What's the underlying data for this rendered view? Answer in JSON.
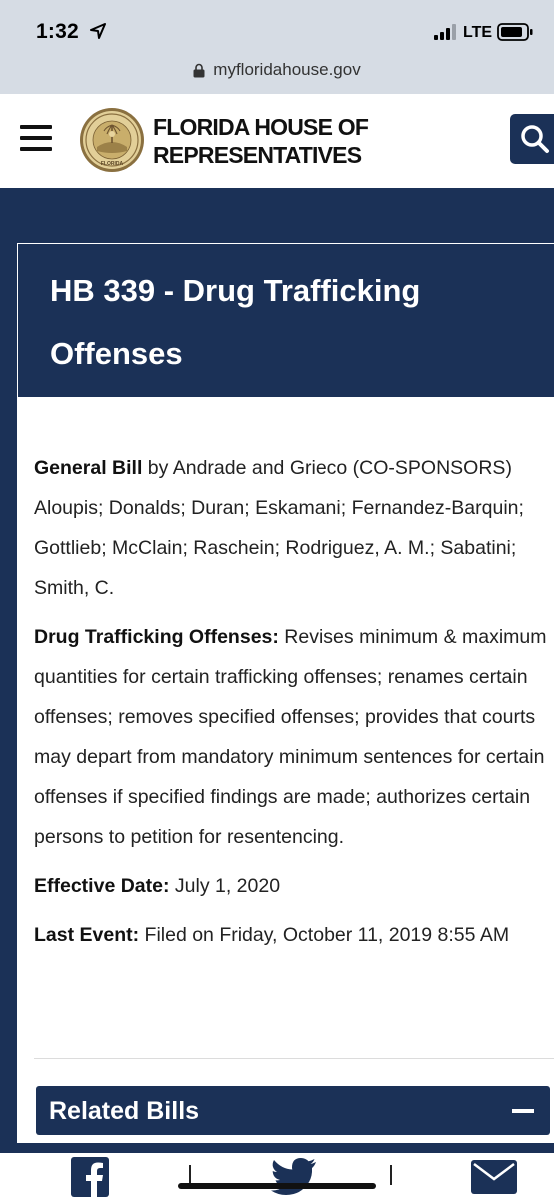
{
  "status_bar": {
    "time": "1:32",
    "network": "LTE"
  },
  "browser": {
    "url": "myfloridahouse.gov"
  },
  "header": {
    "title_line1": "FLORIDA HOUSE OF",
    "title_line2": "REPRESENTATIVES",
    "seal_text": "FLORIDA",
    "brand_color": "#1b3157"
  },
  "bill": {
    "title": "HB 339 - Drug Trafficking Offenses",
    "sponsor_label": "General Bill",
    "sponsor_text": " by Andrade and Grieco (CO-SPONSORS) Aloupis; Donalds; Duran; Eskamani; Fernandez-Barquin; Gottlieb; McClain; Raschein; Rodriguez, A. M.; Sabatini; Smith, C.",
    "summary_label": "Drug Trafficking Offenses:",
    "summary_text": " Revises minimum & maximum quantities for certain trafficking offenses; renames certain offenses; removes specified offenses; provides that courts may depart from mandatory minimum sentences for certain offenses if specified findings are made; authorizes certain persons to petition for resentencing.",
    "effective_label": "Effective Date:",
    "effective_value": " July 1, 2020",
    "last_event_label": "Last Event:",
    "last_event_value": " Filed on Friday, October 11, 2019 8:55 AM"
  },
  "related": {
    "label": "Related Bills"
  },
  "share": {
    "icons": [
      "facebook-icon",
      "twitter-icon",
      "mail-icon"
    ]
  }
}
